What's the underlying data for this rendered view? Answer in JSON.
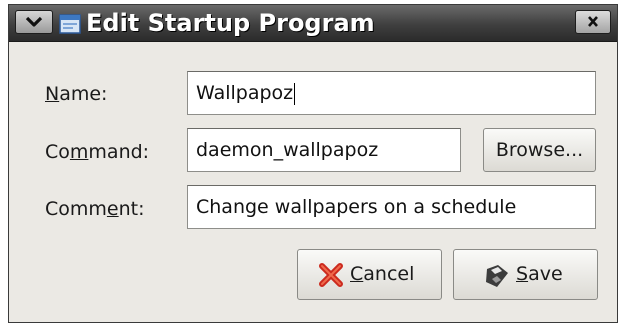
{
  "window": {
    "title": "Edit Startup Program"
  },
  "form": {
    "name": {
      "label_pre": "",
      "label_key": "N",
      "label_post": "ame:",
      "value": "Wallpapoz"
    },
    "command": {
      "label_pre": "Co",
      "label_key": "m",
      "label_post": "mand:",
      "value": "daemon_wallpapoz"
    },
    "comment": {
      "label_pre": "Comm",
      "label_key": "e",
      "label_post": "nt:",
      "value": "Change wallpapers on a schedule"
    }
  },
  "buttons": {
    "browse": "Browse...",
    "cancel": {
      "key": "C",
      "rest": "ancel"
    },
    "save": {
      "key": "S",
      "rest": "ave"
    }
  },
  "icons": {
    "window_menu": "chevron-down-icon",
    "app": "window-icon",
    "close": "close-icon",
    "cancel": "red-x-icon",
    "save": "floppy-disk-icon"
  },
  "colors": {
    "titlebar": "#3f3f3f",
    "dialog": "#ebe9e4",
    "cancel_icon": "#cc2a1e"
  }
}
